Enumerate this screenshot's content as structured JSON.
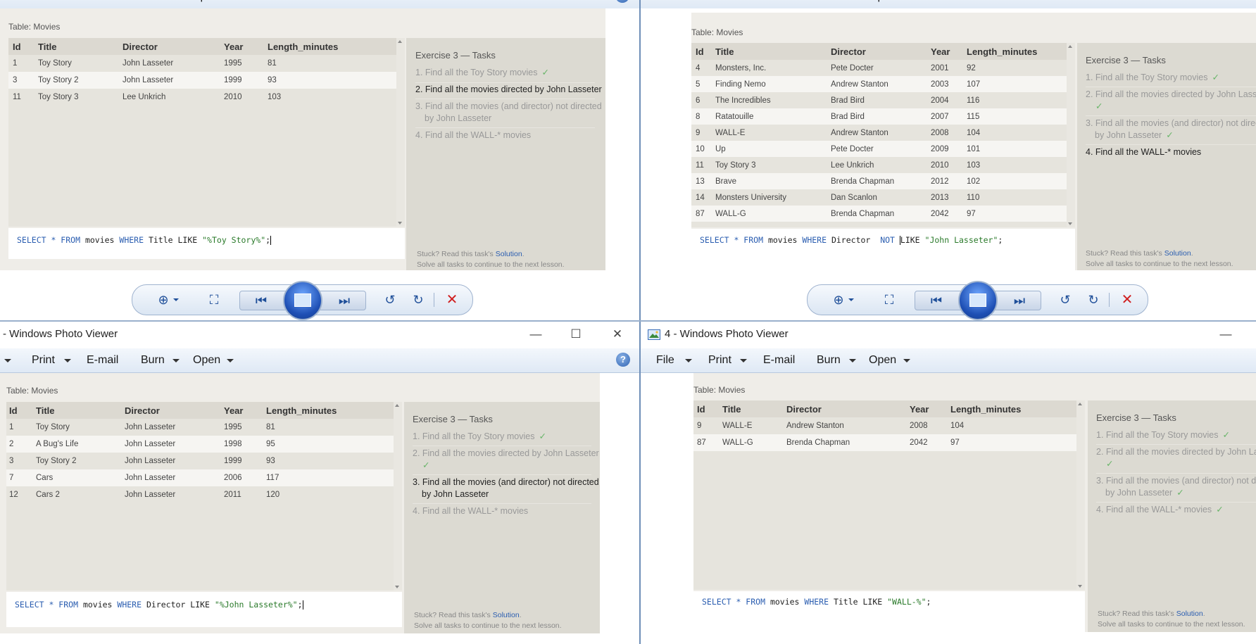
{
  "menu": {
    "file": "File",
    "print": "Print",
    "email": "E-mail",
    "burn": "Burn",
    "open": "Open"
  },
  "toolbar_icons": [
    "zoom-icon",
    "fit-window-icon",
    "previous-icon",
    "slideshow-icon",
    "next-icon",
    "rotate-left-icon",
    "rotate-right-icon",
    "delete-icon"
  ],
  "colors": {
    "keyword": "#2a5db0",
    "string": "#2a7a2a",
    "check": "#6ab56a",
    "link": "#2a5db0",
    "delete": "#d02020"
  },
  "common": {
    "table_caption": "Table: Movies",
    "columns": [
      "Id",
      "Title",
      "Director",
      "Year",
      "Length_minutes"
    ],
    "tasks_heading": "Exercise 3 — Tasks",
    "tasks": [
      "1. Find all the Toy Story movies",
      "2. Find all the movies directed by John Lasseter",
      "3. Find all the movies (and director) not directed",
      "by John Lasseter",
      "4. Find all the WALL-* movies"
    ],
    "check": "✓",
    "stuck_prefix": "Stuck? Read this task's",
    "solution": "Solution",
    "stuck_suffix": ".",
    "continue": "Solve all tasks to continue to the next lesson."
  },
  "windows": {
    "tl": {
      "title": "",
      "rows": [
        [
          "1",
          "Toy Story",
          "John Lasseter",
          "1995",
          "81"
        ],
        [
          "3",
          "Toy Story 2",
          "John Lasseter",
          "1999",
          "93"
        ],
        [
          "11",
          "Toy Story 3",
          "Lee Unkrich",
          "2010",
          "103"
        ]
      ],
      "query": {
        "pre": "SELECT * FROM ",
        "t1": "movies ",
        "kw2": "WHERE ",
        "t2": "Title ",
        "kw3": "LIKE ",
        "str": "\"%Toy Story%\"",
        "post": ";"
      }
    },
    "tr": {
      "title": "",
      "rows": [
        [
          "4",
          "Monsters, Inc.",
          "Pete Docter",
          "2001",
          "92"
        ],
        [
          "5",
          "Finding Nemo",
          "Andrew Stanton",
          "2003",
          "107"
        ],
        [
          "6",
          "The Incredibles",
          "Brad Bird",
          "2004",
          "116"
        ],
        [
          "8",
          "Ratatouille",
          "Brad Bird",
          "2007",
          "115"
        ],
        [
          "9",
          "WALL-E",
          "Andrew Stanton",
          "2008",
          "104"
        ],
        [
          "10",
          "Up",
          "Pete Docter",
          "2009",
          "101"
        ],
        [
          "11",
          "Toy Story 3",
          "Lee Unkrich",
          "2010",
          "103"
        ],
        [
          "13",
          "Brave",
          "Brenda Chapman",
          "2012",
          "102"
        ],
        [
          "14",
          "Monsters University",
          "Dan Scanlon",
          "2013",
          "110"
        ],
        [
          "87",
          "WALL-G",
          "Brenda Chapman",
          "2042",
          "97"
        ]
      ],
      "query": {
        "pre": "SELECT * FROM ",
        "t1": "movies ",
        "kw2": "WHERE ",
        "t2": "Director  ",
        "kw3": "NOT ",
        "kw4": "LIKE ",
        "str": "\"John Lasseter\"",
        "post": ";"
      }
    },
    "bl": {
      "title": "- Windows Photo Viewer",
      "rows": [
        [
          "1",
          "Toy Story",
          "John Lasseter",
          "1995",
          "81"
        ],
        [
          "2",
          "A Bug's Life",
          "John Lasseter",
          "1998",
          "95"
        ],
        [
          "3",
          "Toy Story 2",
          "John Lasseter",
          "1999",
          "93"
        ],
        [
          "7",
          "Cars",
          "John Lasseter",
          "2006",
          "117"
        ],
        [
          "12",
          "Cars 2",
          "John Lasseter",
          "2011",
          "120"
        ]
      ],
      "query": {
        "pre": "SELECT * FROM ",
        "t1": "movies ",
        "kw2": "WHERE ",
        "t2": "Director ",
        "kw3": "LIKE ",
        "str": "\"%John Lasseter%\"",
        "post": ";"
      }
    },
    "br": {
      "title": "4 - Windows Photo Viewer",
      "rows": [
        [
          "9",
          "WALL-E",
          "Andrew Stanton",
          "2008",
          "104"
        ],
        [
          "87",
          "WALL-G",
          "Brenda Chapman",
          "2042",
          "97"
        ]
      ],
      "query": {
        "pre": "SELECT * FROM ",
        "t1": "movies ",
        "kw2": "WHERE ",
        "t2": "Title ",
        "kw3": "LIKE ",
        "str": "\"WALL-%\"",
        "post": ";"
      }
    }
  }
}
